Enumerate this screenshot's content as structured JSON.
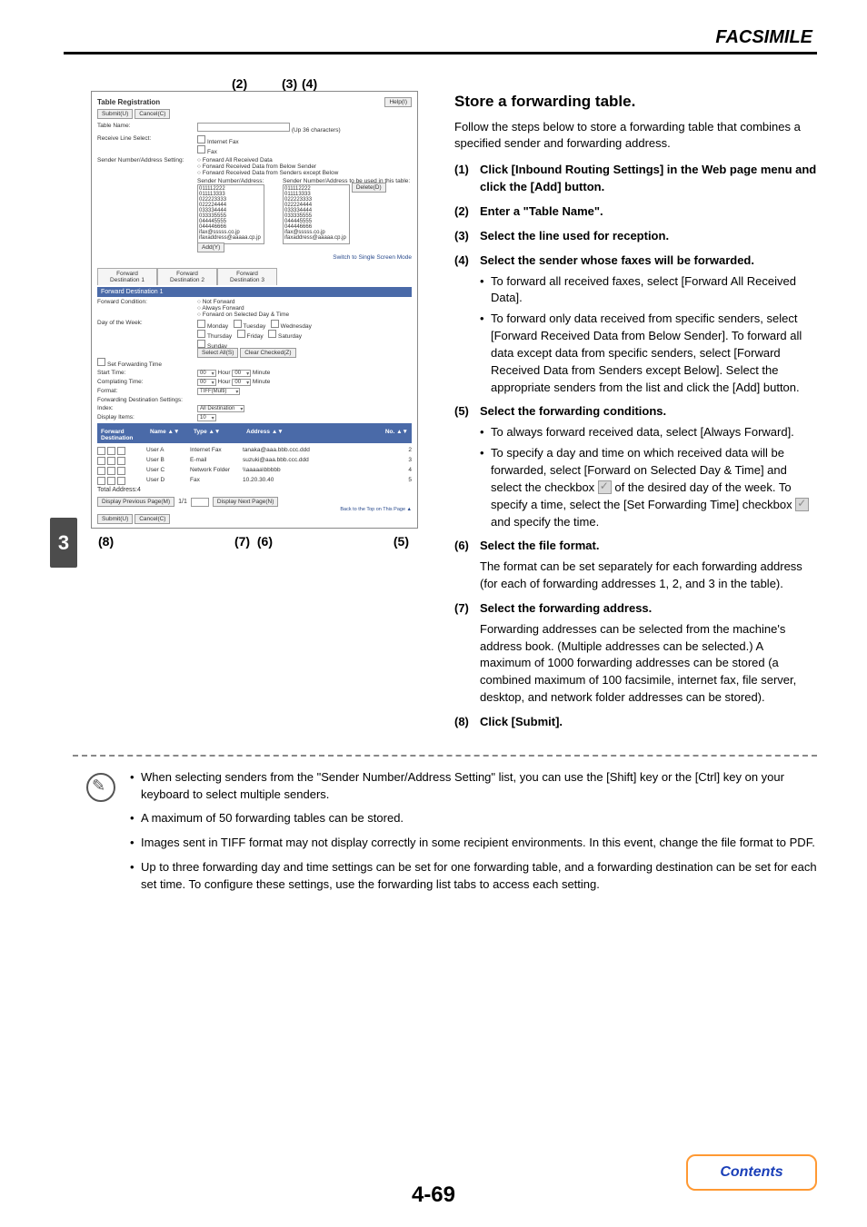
{
  "header": {
    "title": "FACSIMILE"
  },
  "sidebar": {
    "chapter": "3"
  },
  "figure": {
    "callout2": "(2)",
    "callout3": "(3)",
    "callout4": "(4)",
    "callout5": "(5)",
    "callout6": "(6)",
    "callout7": "(7)",
    "callout8": "(8)",
    "panel": {
      "title": "Table Registration",
      "help_btn": "Help(I)",
      "submit_btn": "Submit(U)",
      "cancel_btn": "Cancel(C)",
      "table_name_lbl": "Table Name:",
      "up_lbl": "(Up",
      "up_chars": "36 characters)",
      "receive_line_lbl": "Receive Line Select:",
      "receive_line_ifax": "Internet Fax",
      "receive_line_fax": "Fax",
      "sender_setting_lbl": "Sender Number/Address Setting:",
      "radio_all": "Forward All Received Data",
      "radio_below": "Forward Received Data from Below Sender",
      "radio_except": "Forward Received Data from Senders except Below",
      "sender_col_left": "Sender Number/Address:",
      "sender_col_right": "Sender Number/Address to be used in this table:",
      "list_left": [
        "011112222",
        "011113333",
        "022223333",
        "022224444",
        "033334444",
        "033335555",
        "044445555",
        "044446666",
        "ifax@sssss.co.jp",
        "ifaxaddress@aaaaa.cp.jp"
      ],
      "list_right": [
        "011112222",
        "011113333",
        "022223333",
        "022224444",
        "033334444",
        "033335555",
        "044445555",
        "044446666",
        "ifax@sssss.co.jp",
        "ifaxaddress@aaaaa.cp.jp"
      ],
      "add_btn": "Add(Y)",
      "delete_btn": "Delete(D)",
      "switch_link": "Switch to Single Screen Mode",
      "tab1": "Forward Destination 1",
      "tab2": "Forward Destination 2",
      "tab3": "Forward Destination 3",
      "band1": "Forward Destination 1",
      "cond_lbl": "Forward Condition:",
      "cond_not": "Not Forward",
      "cond_always": "Always Forward",
      "cond_sel": "Forward on Selected Day & Time",
      "dow_lbl": "Day of the Week:",
      "dow_mon": "Monday",
      "dow_tue": "Tuesday",
      "dow_wed": "Wednesday",
      "dow_thu": "Thursday",
      "dow_fri": "Friday",
      "dow_sat": "Saturday",
      "dow_sun": "Sunday",
      "select_all": "Select All(S)",
      "clear_checked": "Clear Checked(Z)",
      "set_time_lbl": "Set Forwarding Time",
      "start_lbl": "Start Time:",
      "end_lbl": "Complating Time:",
      "hour": "Hour",
      "minute": "Minute",
      "zero": "00",
      "format_lbl": "Format:",
      "format_val": "TIFF(Multi)",
      "fds_lbl": "Forwarding Destination Settings:",
      "index_lbl": "Index:",
      "index_val": "All Destination",
      "display_items_lbl": "Display Items:",
      "display_items_val": "10",
      "dest_band": "Forward Destination",
      "col_name": "Name ▲▼",
      "col_type": "Type ▲▼",
      "col_addr": "Address ▲▼",
      "col_no": "No. ▲▼",
      "rows": [
        {
          "name": "User A",
          "type": "Internet Fax",
          "addr": "tanaka@aaa.bbb.ccc.ddd",
          "no": "2"
        },
        {
          "name": "User B",
          "type": "E-mail",
          "addr": "suzuki@aaa.bbb.ccc.ddd",
          "no": "3"
        },
        {
          "name": "User C",
          "type": "Network Folder",
          "addr": "\\\\aaaaa\\bbbbb",
          "no": "4"
        },
        {
          "name": "User D",
          "type": "Fax",
          "addr": "10.20.30.40",
          "no": "5"
        }
      ],
      "total_lbl": "Total Address:4",
      "prev_btn": "Display Previous Page(M)",
      "page_ct": "1/1",
      "next_btn": "Display Next Page(N)",
      "back_top": "Back to the Top on This Page ▲"
    }
  },
  "main": {
    "title": "Store a forwarding table.",
    "intro": "Follow the steps below to store a forwarding table that combines a specified sender and forwarding address.",
    "steps": [
      {
        "n": "(1)",
        "t": "Click [Inbound Routing Settings] in the Web page menu and click the [Add] button."
      },
      {
        "n": "(2)",
        "t": "Enter a \"Table Name\"."
      },
      {
        "n": "(3)",
        "t": "Select the line used for reception."
      },
      {
        "n": "(4)",
        "t": "Select the sender whose faxes will be forwarded."
      },
      {
        "n": "(5)",
        "t": "Select the forwarding conditions."
      },
      {
        "n": "(6)",
        "t": "Select the file format."
      },
      {
        "n": "(7)",
        "t": "Select the forwarding address."
      },
      {
        "n": "(8)",
        "t": "Click [Submit]."
      }
    ],
    "step4_b1": "To forward all received faxes, select [Forward All Received Data].",
    "step4_b2": "To forward only data received from specific senders, select [Forward Received Data from Below Sender]. To forward all data except data from specific senders, select [Forward Received Data from Senders except Below]. Select the appropriate senders from the list and click the [Add] button.",
    "step5_b1": "To always forward received data, select [Always Forward].",
    "step5_b2_a": "To specify a day and time on which received data will be forwarded, select [Forward on Selected Day & Time] and select the checkbox ",
    "step5_b2_b": " of the desired day of the week. To specify a time, select the [Set Forwarding Time] checkbox ",
    "step5_b2_c": " and specify the time.",
    "step6_p": "The format can be set separately for each forwarding address (for each of forwarding addresses 1, 2, and 3 in the table).",
    "step7_p": "Forwarding addresses can be selected from the machine's address book. (Multiple addresses can be selected.) A maximum of 1000 forwarding addresses can be stored (a combined maximum of 100 facsimile, internet fax, file server, desktop, and network folder addresses can be stored)."
  },
  "notes": {
    "n1": "When selecting senders from the \"Sender Number/Address Setting\" list, you can use the [Shift] key or the [Ctrl] key on your keyboard to select multiple senders.",
    "n2": "A maximum of 50 forwarding tables can be stored.",
    "n3": "Images sent in TIFF format may not display correctly in some recipient environments. In this event, change the file format to PDF.",
    "n4": "Up to three forwarding day and time settings can be set for one forwarding table, and a forwarding destination can be set for each set time. To configure these settings, use the forwarding list tabs to access each setting."
  },
  "footer": {
    "page_num": "4-69",
    "contents": "Contents"
  }
}
